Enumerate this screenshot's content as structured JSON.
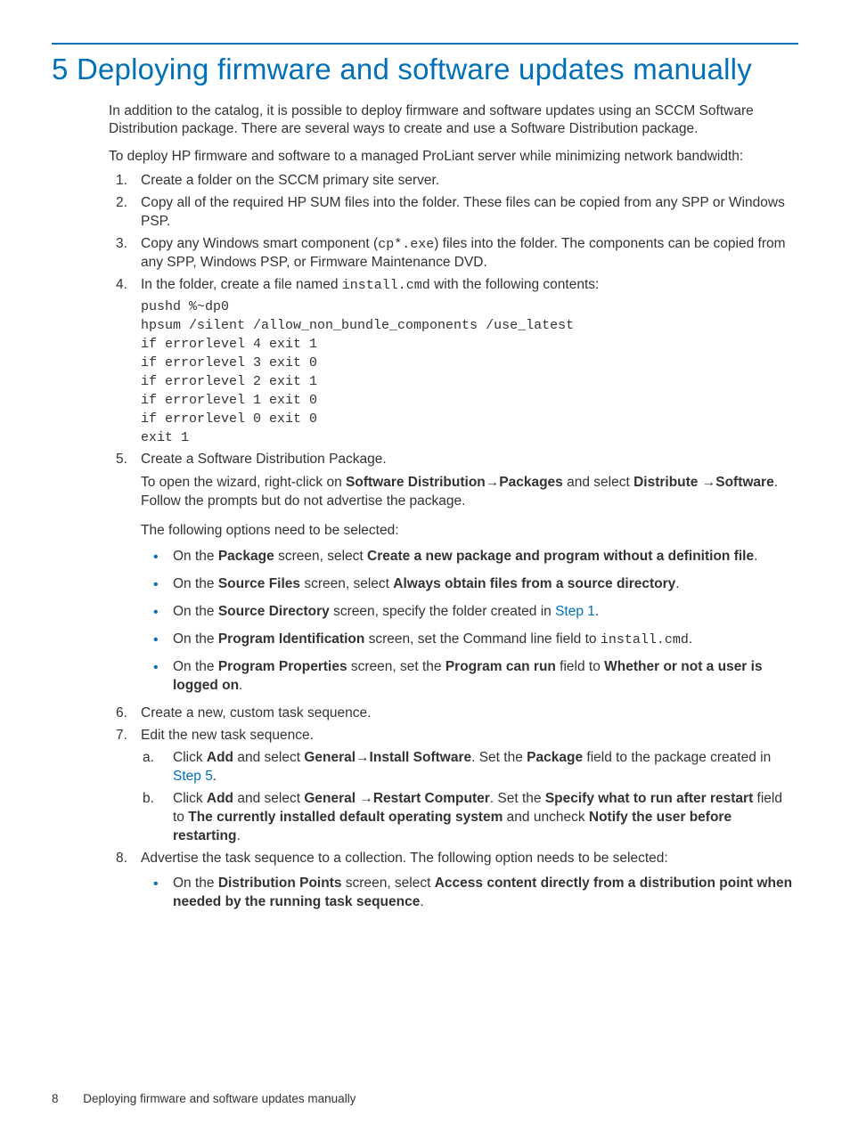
{
  "title_num": "5",
  "title_text": "Deploying firmware and software updates manually",
  "intro": "In addition to the catalog, it is possible to deploy firmware and software updates using an SCCM Software Distribution package. There are several ways to create and use a Software Distribution package.",
  "intro2": "To deploy HP firmware and software to a managed ProLiant server while minimizing network bandwidth:",
  "s1": {
    "n": "1.",
    "t": "Create a folder on the SCCM primary site server."
  },
  "s2": {
    "n": "2.",
    "t": "Copy all of the required HP SUM files into the folder. These files can be copied from any SPP or Windows PSP."
  },
  "s3": {
    "n": "3.",
    "a": "Copy any Windows smart component (",
    "code": "cp*.exe",
    "b": ") files into the folder. The components can be copied from any SPP, Windows PSP, or Firmware Maintenance DVD."
  },
  "s4": {
    "n": "4.",
    "a": "In the folder, create a file named ",
    "code": "install.cmd",
    "b": " with the following contents:",
    "block": "pushd %~dp0\nhpsum /silent /allow_non_bundle_components /use_latest\nif errorlevel 4 exit 1\nif errorlevel 3 exit 0\nif errorlevel 2 exit 1\nif errorlevel 1 exit 0\nif errorlevel 0 exit 0\nexit 1"
  },
  "s5": {
    "n": "5.",
    "t": "Create a Software Distribution Package.",
    "wiz_a": "To open the wizard, right-click on ",
    "wiz_b1": "Software Distribution",
    "wiz_arr": "→",
    "wiz_b2": "Packages",
    "wiz_c": " and select ",
    "wiz_b3": "Distribute",
    "wiz_d": "Software",
    "wiz_e": ". Follow the prompts but do not advertise the package.",
    "opts_lead": "The following options need to be selected:",
    "b1_a": "On the ",
    "b1_b": "Package",
    "b1_c": " screen, select ",
    "b1_d": "Create a new package and program without a definition file",
    "b1_e": ".",
    "b2_a": "On the ",
    "b2_b": "Source Files",
    "b2_c": " screen, select ",
    "b2_d": "Always obtain files from a source directory",
    "b2_e": ".",
    "b3_a": "On the ",
    "b3_b": "Source Directory",
    "b3_c": " screen, specify the folder created in ",
    "b3_link": "Step 1",
    "b3_e": ".",
    "b4_a": "On the ",
    "b4_b": "Program Identification",
    "b4_c": " screen, set the Command line field to ",
    "b4_code": "install.cmd",
    "b4_e": ".",
    "b5_a": "On the ",
    "b5_b": "Program Properties",
    "b5_c": " screen, set the ",
    "b5_d": "Program can run",
    "b5_e": " field to ",
    "b5_f": "Whether or not a user is logged on",
    "b5_g": "."
  },
  "s6": {
    "n": "6.",
    "t": "Create a new, custom task sequence."
  },
  "s7": {
    "n": "7.",
    "t": "Edit the new task sequence.",
    "a_n": "a.",
    "a_1": "Click ",
    "a_b1": "Add",
    "a_2": " and select ",
    "a_b2": "General",
    "a_arr": "→",
    "a_b3": "Install Software",
    "a_3": ". Set the ",
    "a_b4": "Package",
    "a_4": " field to the package created in ",
    "a_link": "Step 5",
    "a_5": ".",
    "b_n": "b.",
    "b_1": "Click ",
    "b_b1": "Add",
    "b_2": " and select ",
    "b_b2": "General ",
    "b_arr": "→",
    "b_b3": "Restart Computer",
    "b_3": ". Set the ",
    "b_b4": "Specify what to run after restart",
    "b_4": " field to ",
    "b_b5": "The currently installed default operating system",
    "b_5": " and uncheck ",
    "b_b6": "Notify the user before restarting",
    "b_6": "."
  },
  "s8": {
    "n": "8.",
    "t": "Advertise the task sequence to a collection. The following option needs to be selected:",
    "b1_a": "On the ",
    "b1_b": "Distribution Points",
    "b1_c": " screen, select ",
    "b1_d": "Access content directly from a distribution point when needed by the running task sequence",
    "b1_e": "."
  },
  "footer": {
    "page": "8",
    "text": "Deploying firmware and software updates manually"
  }
}
